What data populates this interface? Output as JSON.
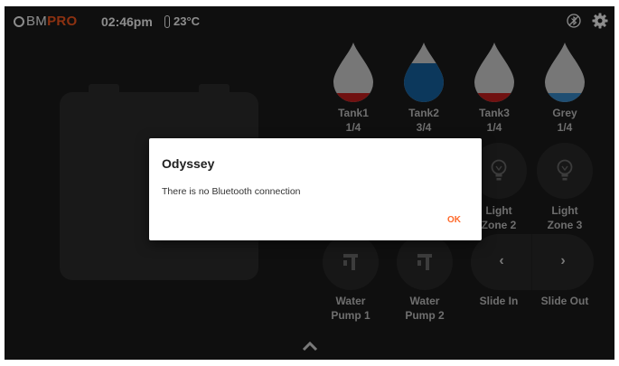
{
  "status": {
    "logo_bm": "BM",
    "logo_pro": "PRO",
    "time": "02:46pm",
    "temperature": "23°C"
  },
  "tanks": [
    {
      "name": "Tank1",
      "level": "1/4",
      "fill_fraction": 0.1,
      "color": "#cc1f1f"
    },
    {
      "name": "Tank2",
      "level": "3/4",
      "fill_fraction": 0.7,
      "color": "#1666a8"
    },
    {
      "name": "Tank3",
      "level": "1/4",
      "fill_fraction": 0.1,
      "color": "#cc1f1f"
    },
    {
      "name": "Grey",
      "level": "1/4",
      "fill_fraction": 0.1,
      "color": "#3a8fd0"
    }
  ],
  "lights": {
    "zone2": "Light Zone 2",
    "zone2_a": "Light",
    "zone2_b": "Zone 2",
    "zone3_a": "Light",
    "zone3_b": "Zone 3"
  },
  "pumps": {
    "pump1_a": "Water",
    "pump1_b": "Pump 1",
    "pump2_a": "Water",
    "pump2_b": "Pump 2"
  },
  "slides": {
    "in_label": "Slide In",
    "out_label": "Slide Out",
    "in_glyph": "‹",
    "out_glyph": "›"
  },
  "dialog": {
    "title": "Odyssey",
    "message": "There is no Bluetooth connection",
    "ok": "OK"
  },
  "colors": {
    "accent": "#ff6a2b",
    "background": "#1c1c1c",
    "button": "#2b2b2b"
  },
  "icons": [
    "bluetooth-off-icon",
    "gear-icon",
    "thermometer-icon",
    "bulb-icon",
    "faucet-icon",
    "chevron-up-icon"
  ]
}
